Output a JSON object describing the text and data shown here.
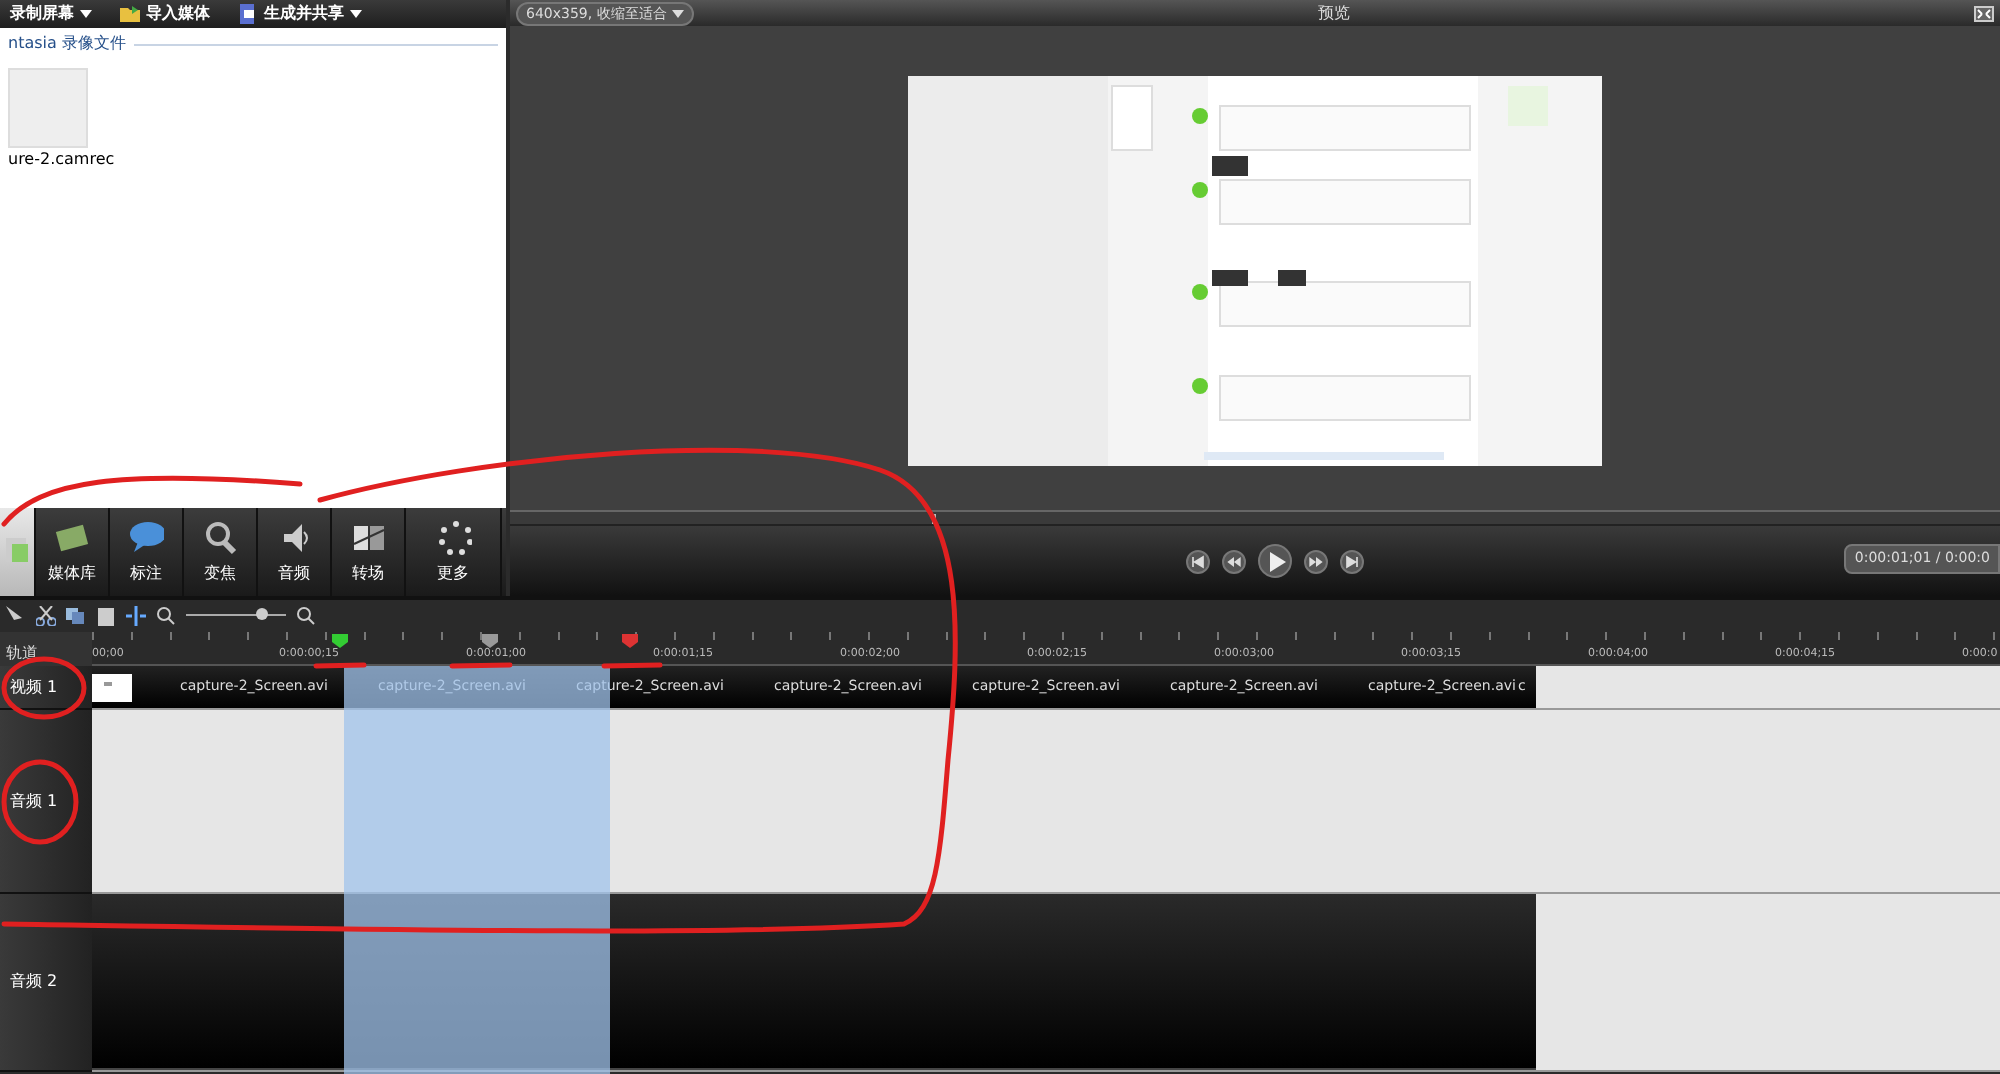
{
  "toolbar": {
    "buttons": [
      {
        "label": "录制屏幕",
        "caret": true
      },
      {
        "label": "导入媒体",
        "caret": false
      },
      {
        "label": "生成并共享",
        "caret": true
      }
    ]
  },
  "clip_bin": {
    "group": "ntasia 录像文件",
    "files": [
      {
        "name": "ure-2.camrec"
      }
    ]
  },
  "preview": {
    "size_menu": "640x359, 收缩至适合",
    "title": "预览",
    "level": 0.283,
    "time": "0:00:01;01 / 0:00:0"
  },
  "task_tabs": [
    {
      "kind": "clip",
      "selected": true
    },
    {
      "kind": "library",
      "label": "媒体库",
      "selected": false
    },
    {
      "kind": "callout",
      "label": "标注",
      "selected": false
    },
    {
      "kind": "zoom",
      "label": "变焦",
      "selected": false
    },
    {
      "kind": "audio",
      "label": "音频",
      "selected": false
    },
    {
      "kind": "transition",
      "label": "转场",
      "selected": false
    },
    {
      "kind": "more",
      "label": "更多",
      "selected": false
    }
  ],
  "timeline": {
    "level": 0.75,
    "track_header": "轨道",
    "ruler": [
      "00;00",
      "0:00:00;15",
      "0:00:01;00",
      "0:00:01;15",
      "0:00:02;00",
      "0:00:02;15",
      "0:00:03;00",
      "0:00:03;15",
      "0:00:04;00",
      "0:00:04;15",
      "0:00:0"
    ],
    "tracks": [
      {
        "label": "视频 1",
        "kind": "video",
        "clips": [
          "capture-2_Screen.avi",
          "capture-2_Screen.avi",
          "capture-2_Screen.avi",
          "capture-2_Screen.avi",
          "capture-2_Screen.avi",
          "capture-2_Screen.avi",
          "capture-2_Screen.avi",
          "c"
        ]
      },
      {
        "label": "音频 1",
        "kind": "empty"
      },
      {
        "label": "音频 2",
        "kind": "audio"
      }
    ]
  }
}
